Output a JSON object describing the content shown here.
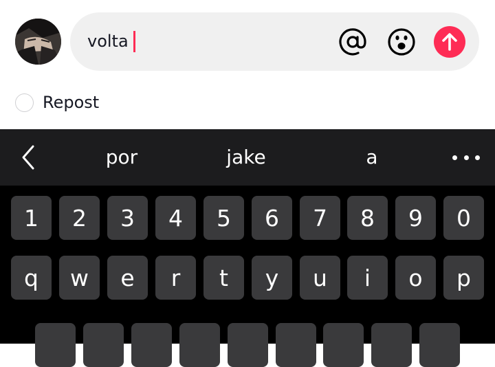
{
  "composer": {
    "input_value": "volta",
    "at_icon": "at-icon",
    "emoji_icon": "emoji-icon",
    "send_icon": "arrow-up-icon",
    "accent_color": "#fe2c55"
  },
  "repost": {
    "label": "Repost",
    "checked": false
  },
  "keyboard": {
    "suggestions": [
      "por",
      "jake",
      "a"
    ],
    "back_icon": "chevron-left-icon",
    "more_icon": "ellipsis-icon",
    "number_row": [
      "1",
      "2",
      "3",
      "4",
      "5",
      "6",
      "7",
      "8",
      "9",
      "0"
    ],
    "qwerty_row": [
      "q",
      "w",
      "e",
      "r",
      "t",
      "y",
      "u",
      "i",
      "o",
      "p"
    ]
  }
}
